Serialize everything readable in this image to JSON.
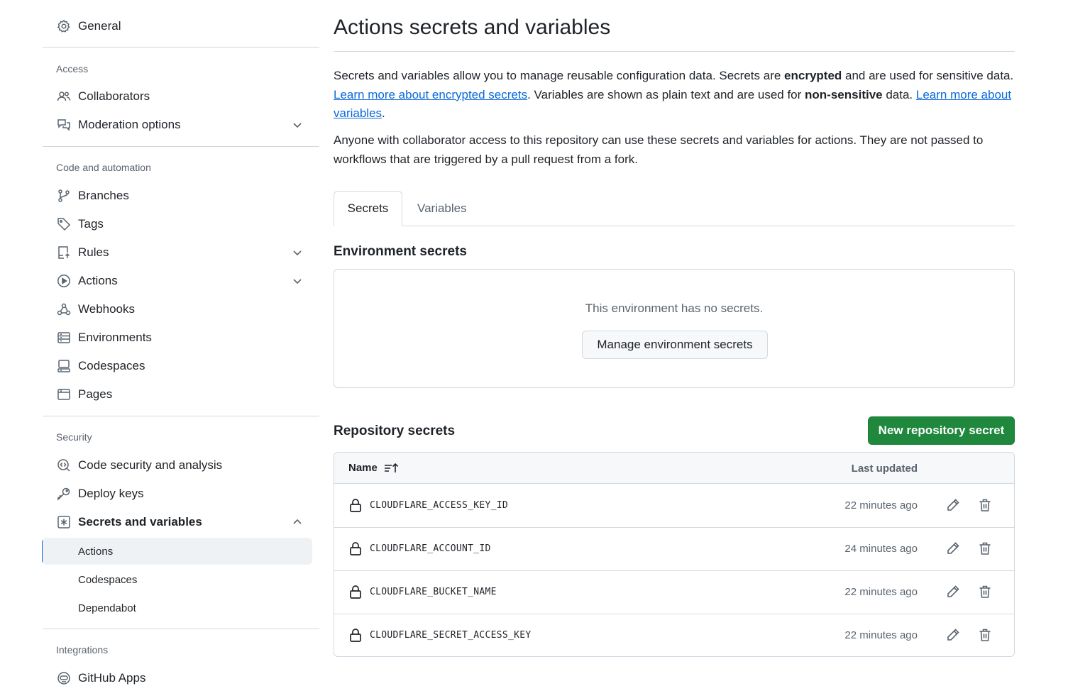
{
  "sidebar": {
    "general": "General",
    "groups": {
      "access": "Access",
      "code_automation": "Code and automation",
      "security": "Security",
      "integrations": "Integrations"
    },
    "items": {
      "collaborators": "Collaborators",
      "moderation": "Moderation options",
      "branches": "Branches",
      "tags": "Tags",
      "rules": "Rules",
      "actions": "Actions",
      "webhooks": "Webhooks",
      "environments": "Environments",
      "codespaces": "Codespaces",
      "pages": "Pages",
      "code_security": "Code security and analysis",
      "deploy_keys": "Deploy keys",
      "secrets_variables": "Secrets and variables",
      "github_apps": "GitHub Apps"
    },
    "sub_items": {
      "actions": "Actions",
      "codespaces": "Codespaces",
      "dependabot": "Dependabot"
    },
    "active_item": "Actions"
  },
  "main": {
    "title": "Actions secrets and variables",
    "desc1": {
      "p1": "Secrets and variables allow you to manage reusable configuration data. Secrets are ",
      "b1": "encrypted",
      "p2": " and are used for sensitive data. ",
      "link1": "Learn more about encrypted secrets",
      "p3": ". Variables are shown as plain text and are used for ",
      "b2": "non-sensitive",
      "p4": " data. ",
      "link2": "Learn more about variables",
      "p5": "."
    },
    "desc2": "Anyone with collaborator access to this repository can use these secrets and variables for actions. They are not passed to workflows that are triggered by a pull request from a fork.",
    "tabs": {
      "secrets": "Secrets",
      "variables": "Variables",
      "selected": "Secrets"
    },
    "environment": {
      "title": "Environment secrets",
      "empty_message": "This environment has no secrets.",
      "manage_button": "Manage environment secrets"
    },
    "repository": {
      "title": "Repository secrets",
      "new_button": "New repository secret",
      "columns": {
        "name": "Name",
        "last_updated": "Last updated"
      },
      "secrets": [
        {
          "name": "CLOUDFLARE_ACCESS_KEY_ID",
          "updated": "22 minutes ago"
        },
        {
          "name": "CLOUDFLARE_ACCOUNT_ID",
          "updated": "24 minutes ago"
        },
        {
          "name": "CLOUDFLARE_BUCKET_NAME",
          "updated": "22 minutes ago"
        },
        {
          "name": "CLOUDFLARE_SECRET_ACCESS_KEY",
          "updated": "22 minutes ago"
        }
      ]
    }
  },
  "colors": {
    "accent": "#0969da",
    "primary_button": "#1f883d",
    "border": "#d1d9e0",
    "muted_text": "#59636e"
  }
}
